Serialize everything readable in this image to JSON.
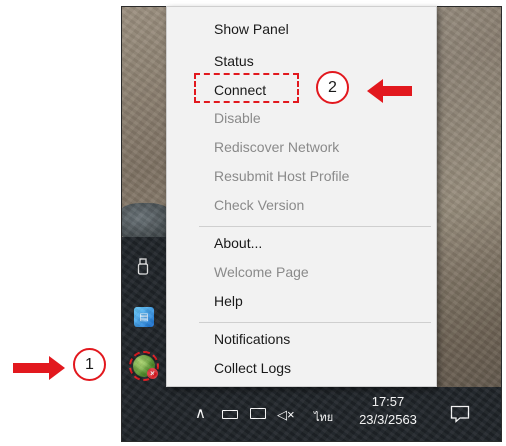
{
  "menu": {
    "items": [
      {
        "label": "Show Panel",
        "enabled": true
      },
      {
        "label": "Status",
        "enabled": true
      },
      {
        "label": "Connect",
        "enabled": true
      },
      {
        "label": "Disable",
        "enabled": false
      },
      {
        "label": "Rediscover Network",
        "enabled": false
      },
      {
        "label": "Resubmit Host Profile",
        "enabled": false
      },
      {
        "label": "Check Version",
        "enabled": false
      },
      {
        "label": "About...",
        "enabled": true
      },
      {
        "label": "Welcome Page",
        "enabled": false
      },
      {
        "label": "Help",
        "enabled": true
      },
      {
        "label": "Notifications",
        "enabled": true
      },
      {
        "label": "Collect Logs",
        "enabled": true
      }
    ]
  },
  "annotations": {
    "step1": "1",
    "step2": "2",
    "color": "#e2181e"
  },
  "taskbar": {
    "language": "ไทย",
    "time": "17:57",
    "date": "23/3/2563",
    "icons": [
      "chevron-up-icon",
      "battery-icon",
      "network-icon",
      "volume-muted-icon",
      "notification-icon"
    ]
  },
  "tray": {
    "icons": [
      "usb-drive-icon",
      "app-icon",
      "globe-client-icon"
    ]
  }
}
